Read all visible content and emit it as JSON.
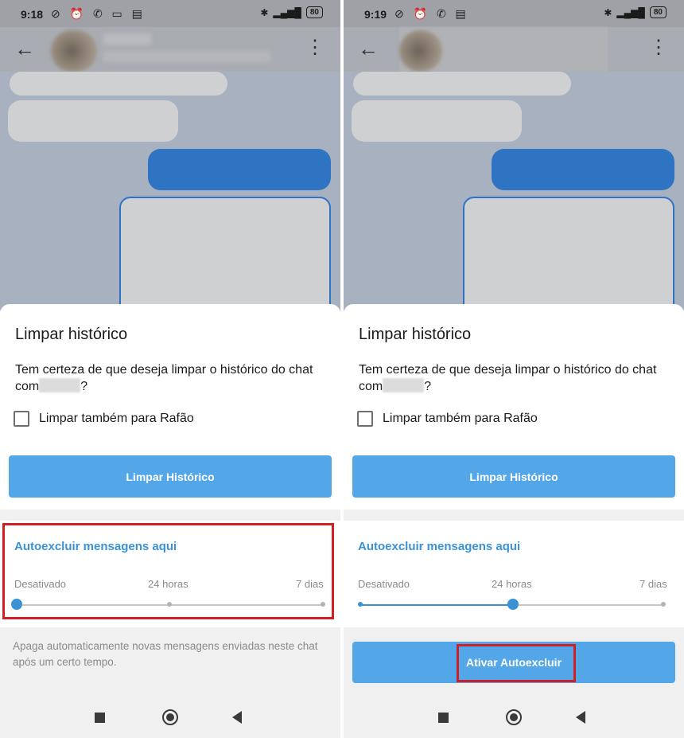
{
  "left": {
    "status": {
      "time": "9:18",
      "battery": "80"
    },
    "dialog": {
      "title": "Limpar histórico",
      "message_prefix": "Tem certeza de que deseja limpar o histórico do chat com",
      "message_suffix": "?",
      "checkbox_label": "Limpar também para Rafão",
      "clear_button": "Limpar Histórico"
    },
    "autodelete": {
      "title": "Autoexcluir mensagens aqui",
      "options": [
        "Desativado",
        "24 horas",
        "7 dias"
      ],
      "selected": "Desativado",
      "info": "Apaga automaticamente novas mensagens enviadas neste chat após um certo tempo."
    }
  },
  "right": {
    "status": {
      "time": "9:19",
      "battery": "80"
    },
    "dialog": {
      "title": "Limpar histórico",
      "message_prefix": "Tem certeza de que deseja limpar o histórico do chat com",
      "message_suffix": "?",
      "checkbox_label": "Limpar também para Rafão",
      "clear_button": "Limpar Histórico"
    },
    "autodelete": {
      "title": "Autoexcluir mensagens aqui",
      "options": [
        "Desativado",
        "24 horas",
        "7 dias"
      ],
      "selected": "24 horas",
      "activate_button": "Ativar Autoexcluir"
    }
  },
  "icons": {
    "back": "arrow-left-icon",
    "more": "more-vertical-icon",
    "bluetooth": "bluetooth-icon",
    "signal": "signal-icon",
    "battery": "battery-icon"
  },
  "colors": {
    "accent": "#3a92d5",
    "button": "#53a7e8",
    "outgoing_bubble": "#2e74c2",
    "highlight": "#d11d24"
  }
}
